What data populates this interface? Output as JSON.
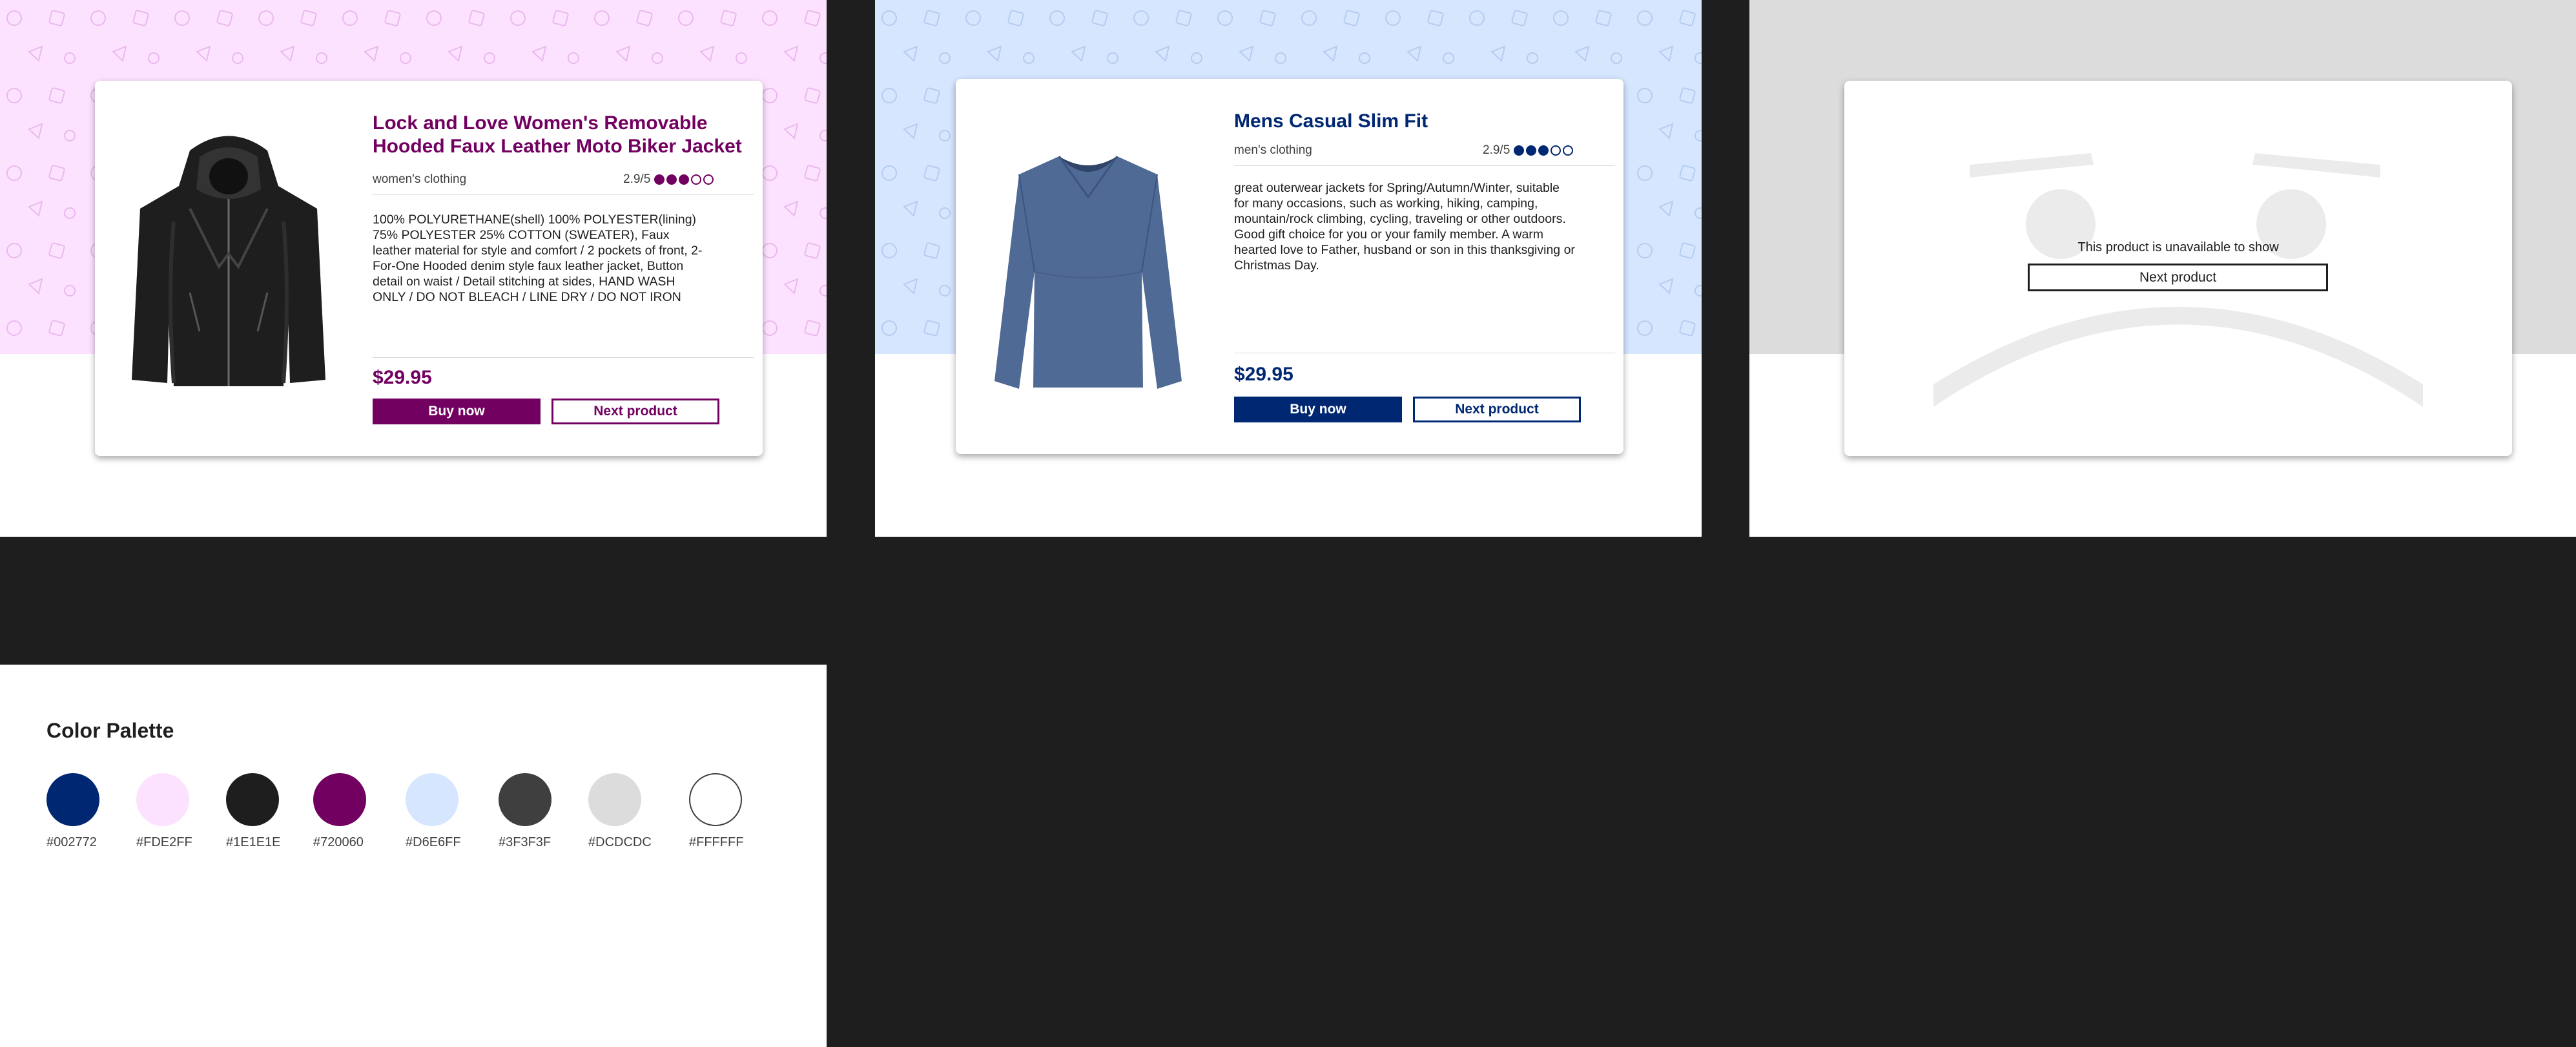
{
  "colors": {
    "navy": "#002772",
    "pink": "#FDE2FF",
    "dark": "#1E1E1E",
    "purple": "#720060",
    "light_blue": "#D6E6FF",
    "gray": "#3F3F3F",
    "light_gray": "#DCDCDC",
    "white": "#FFFFFF"
  },
  "cards": [
    {
      "theme": "purple",
      "image": "black-leather-jacket-image",
      "title": "Lock and Love Women's Removable Hooded Faux Leather Moto Biker Jacket",
      "category": "women's clothing",
      "rating_text": "2.9/5",
      "rating_value": 2.9,
      "rating_max": 5,
      "description": "100% POLYURETHANE(shell) 100% POLYESTER(lining) 75% POLYESTER 25% COTTON (SWEATER), Faux leather material for style and comfort / 2 pockets of front, 2-For-One Hooded denim style faux leather jacket, Button detail on waist / Detail stitching at sides, HAND WASH ONLY / DO NOT BLEACH / LINE DRY / DO NOT IRON",
      "price": "$29.95",
      "buy_label": "Buy now",
      "next_label": "Next product"
    },
    {
      "theme": "navy",
      "image": "blue-long-sleeve-shirt-image",
      "title": "Mens Casual Slim Fit",
      "category": "men's clothing",
      "rating_text": "2.9/5",
      "rating_value": 2.9,
      "rating_max": 5,
      "description": "great outerwear jackets for Spring/Autumn/Winter, suitable for many occasions, such as working, hiking, camping, mountain/rock climbing, cycling, traveling or other outdoors. Good gift choice for you or your family member. A warm hearted love to Father, husband or son in this thanksgiving or Christmas Day.",
      "price": "$29.95",
      "buy_label": "Buy now",
      "next_label": "Next product"
    }
  ],
  "unavailable": {
    "message": "This product is unavailable to show",
    "next_label": "Next product",
    "illustration": "sad-face-illustration"
  },
  "palette": {
    "title": "Color Palette",
    "swatches": [
      "#002772",
      "#FDE2FF",
      "#1E1E1E",
      "#720060",
      "#D6E6FF",
      "#3F3F3F",
      "#DCDCDC",
      "#FFFFFF"
    ]
  }
}
